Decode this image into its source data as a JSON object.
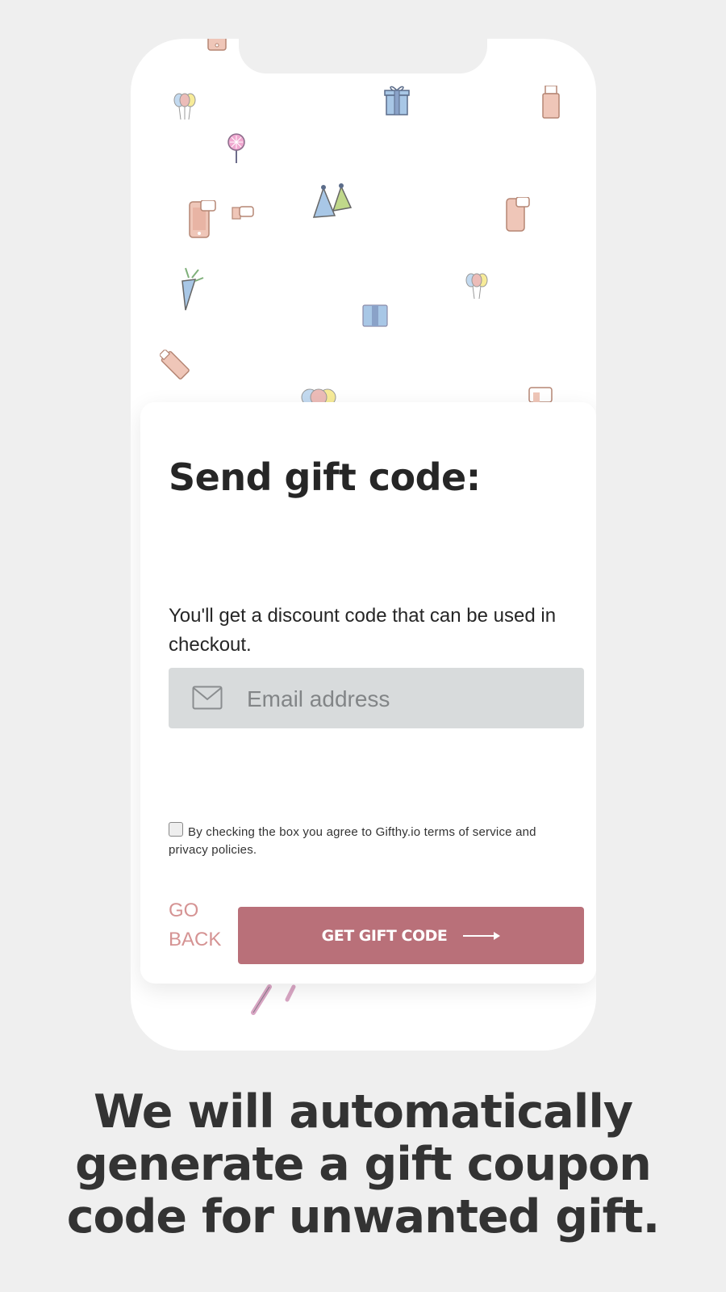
{
  "card": {
    "title": "Send gift code:",
    "description": "You'll get a discount code that can be used in checkout.",
    "email_placeholder": "Email address",
    "consent_text": "By checking the box you agree to Gifthy.io terms of service and privacy policies.",
    "go_back_label": "GO BACK",
    "submit_label": "GET GIFT CODE"
  },
  "tagline": "We will automatically generate a gift coupon code for unwanted gift.",
  "colors": {
    "background": "#efefef",
    "card": "#ffffff",
    "input_bg": "#d8dbdc",
    "button": "#b97079",
    "go_back": "#d59393",
    "heading": "#262626"
  },
  "icons": [
    "mail-icon",
    "arrow-right-icon",
    "balloons-icon",
    "gift-box-icon",
    "phone-icon",
    "usb-drive-icon",
    "lollipop-icon",
    "party-hats-icon",
    "party-popper-icon",
    "chat-bubble-icon"
  ]
}
